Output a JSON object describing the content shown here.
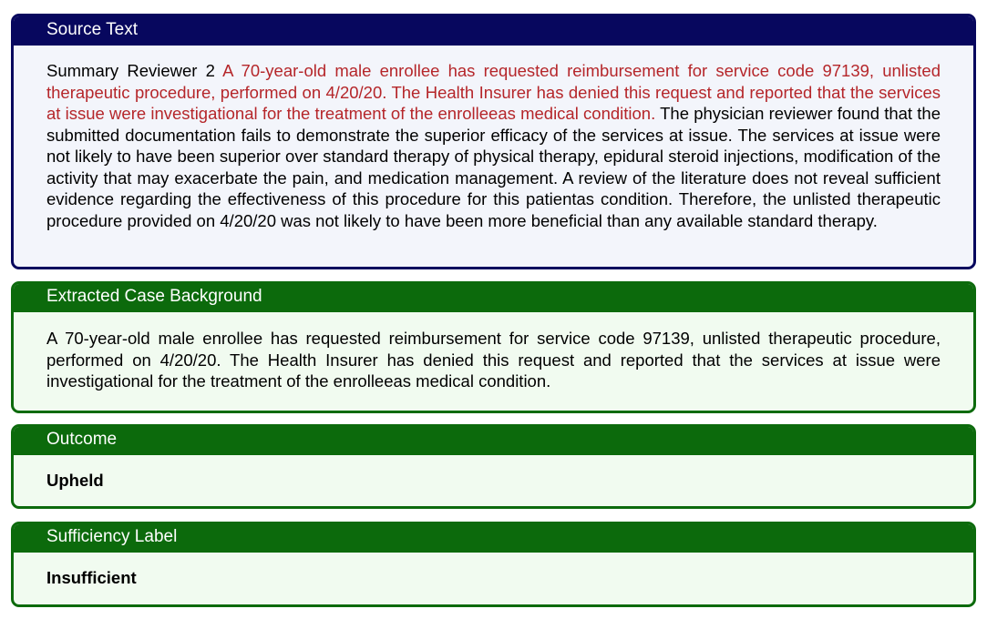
{
  "source": {
    "header": "Source Text",
    "prefix": "Summary Reviewer 2 ",
    "highlighted": "A 70-year-old male enrollee has requested reimbursement for service code 97139, unlisted therapeutic procedure, performed on 4/20/20.  The Health Insurer has denied this request and reported that the services at issue were investigational for the treatment of the enrolleeas medical condition.",
    "rest": " The physician reviewer found that the submitted documentation fails to demonstrate the superior efficacy of the services at issue. The services at issue were not likely to have been superior over standard therapy of physical therapy, epidural steroid injections, modification of the activity that may exacerbate the pain, and medication management. A review of the literature does not reveal sufficient evidence regarding the effectiveness of this procedure for this patientas condition. Therefore, the unlisted therapeutic procedure provided on 4/20/20 was not likely to have been more beneficial than any available standard therapy."
  },
  "background": {
    "header": "Extracted Case Background",
    "text": "A 70-year-old male enrollee has requested reimbursement for service code 97139, unlisted therapeutic procedure, performed on 4/20/20.  The Health Insurer has denied this request and reported that the services at issue were investigational for the treatment of the enrolleeas medical condition."
  },
  "outcome": {
    "header": "Outcome",
    "value": "Upheld"
  },
  "sufficiency": {
    "header": "Sufficiency Label",
    "value": "Insufficient"
  },
  "colors": {
    "source_header": "#07075e",
    "green_header": "#0c6a0c",
    "highlight_text": "#b5262a",
    "source_body_bg": "#f3f5fb",
    "green_body_bg": "#f1fbf0"
  }
}
